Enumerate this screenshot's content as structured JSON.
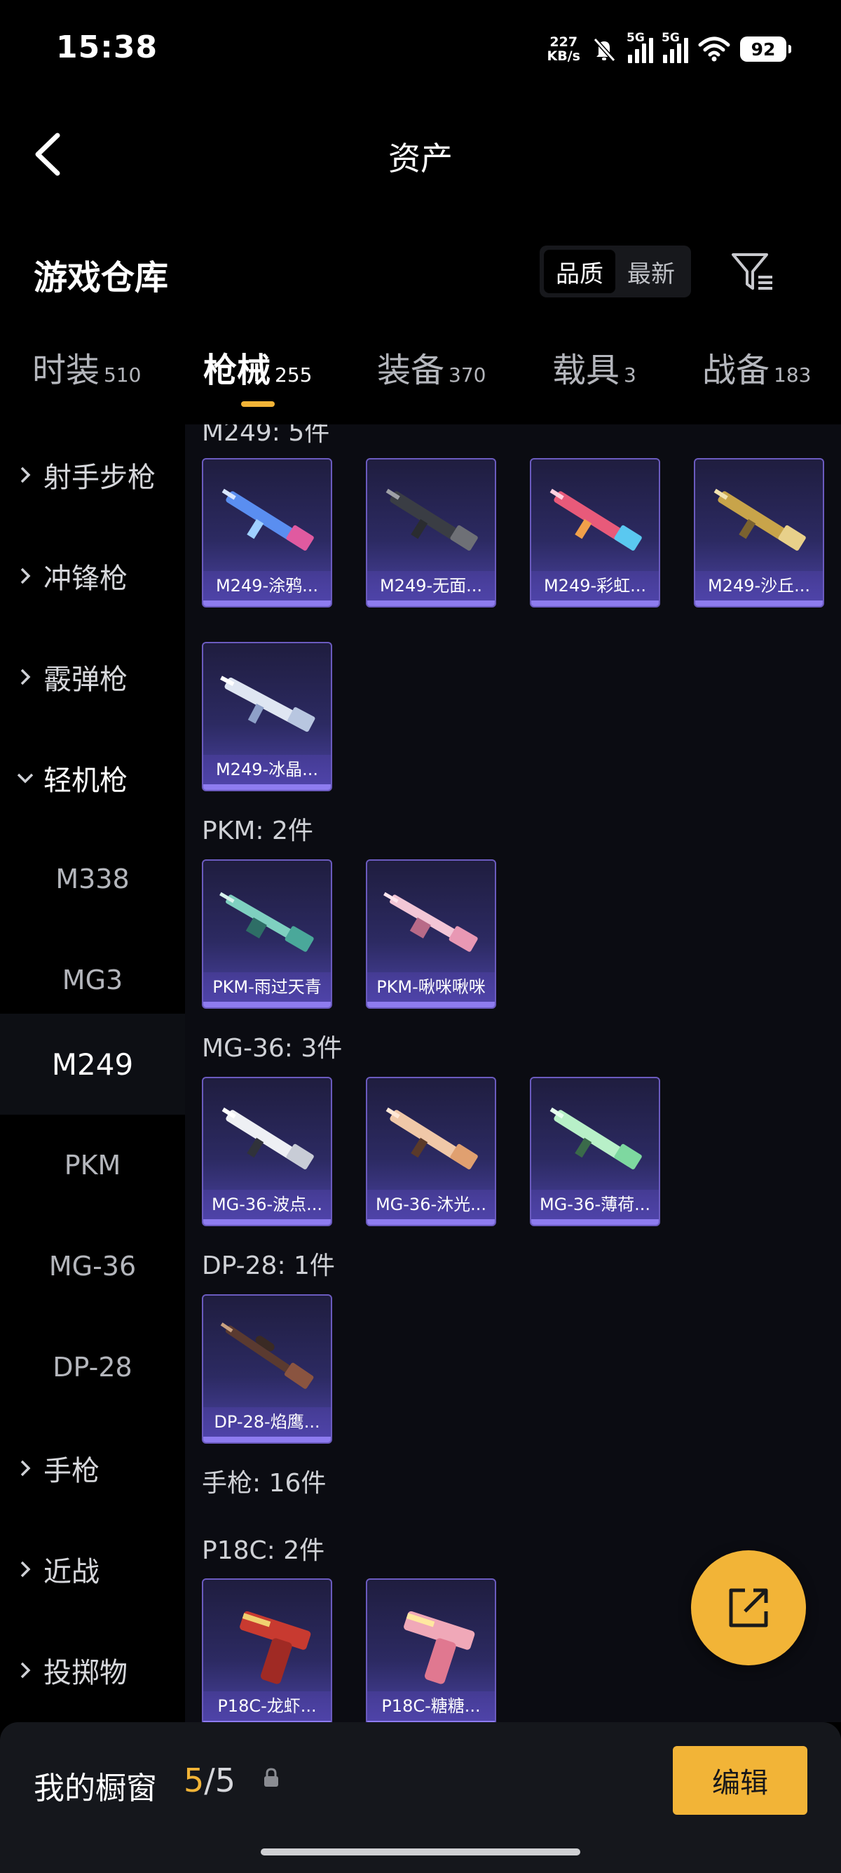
{
  "status_bar": {
    "time": "15:38",
    "net_speed_value": "227",
    "net_speed_unit": "KB/s",
    "signal1_label": "5G",
    "signal2_label": "5G",
    "battery": "92"
  },
  "header": {
    "title": "资产"
  },
  "warehouse": {
    "title": "游戏仓库",
    "sort_options": [
      "品质",
      "最新"
    ],
    "sort_active": "品质"
  },
  "tabs": [
    {
      "label": "时装",
      "count": "510"
    },
    {
      "label": "枪械",
      "count": "255"
    },
    {
      "label": "装备",
      "count": "370"
    },
    {
      "label": "载具",
      "count": "3"
    },
    {
      "label": "战备",
      "count": "183"
    }
  ],
  "active_tab": "枪械",
  "sidebar": {
    "items": [
      {
        "label": "射手步枪",
        "expanded": false
      },
      {
        "label": "冲锋枪",
        "expanded": false
      },
      {
        "label": "霰弹枪",
        "expanded": false
      },
      {
        "label": "轻机枪",
        "expanded": true
      },
      {
        "label": "手枪",
        "expanded": false
      },
      {
        "label": "近战",
        "expanded": false
      },
      {
        "label": "投掷物",
        "expanded": false
      }
    ],
    "subitems": [
      "M338",
      "MG3",
      "M249",
      "PKM",
      "MG-36",
      "DP-28"
    ],
    "active_subitem": "M249"
  },
  "sections": {
    "m249_title": "M249: 5件",
    "m249_items": [
      "M249-涂鸦...",
      "M249-无面...",
      "M249-彩虹...",
      "M249-沙丘...",
      "M249-冰晶..."
    ],
    "pkm_title": "PKM: 2件",
    "pkm_items": [
      "PKM-雨过天青",
      "PKM-啾咪啾咪"
    ],
    "mg36_title": "MG-36: 3件",
    "mg36_items": [
      "MG-36-波点...",
      "MG-36-沐光...",
      "MG-36-薄荷..."
    ],
    "dp28_title": "DP-28: 1件",
    "dp28_items": [
      "DP-28-焰鹰..."
    ],
    "pistol_title": "手枪: 16件",
    "p18c_title": "P18C: 2件",
    "p18c_items": [
      "P18C-龙虾...",
      "P18C-糖糖..."
    ]
  },
  "showcase": {
    "label": "我的橱窗",
    "current": "5",
    "total": "/5",
    "edit_label": "编辑"
  },
  "colors": {
    "accent": "#f2b437",
    "background": "#000000",
    "content_bg": "#0b0c12",
    "card_border": "#6b5bbf",
    "card_bottom": "#8e7cf0"
  }
}
